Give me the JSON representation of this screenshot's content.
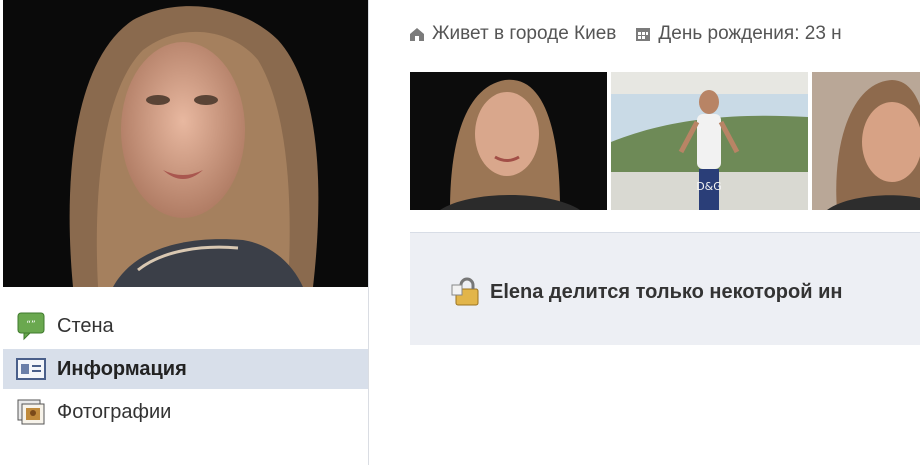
{
  "info": {
    "city": "Живет в городе Киев",
    "birthday": "День рождения: 23 н"
  },
  "nav": {
    "items": [
      {
        "label": "Стена"
      },
      {
        "label": "Информация"
      },
      {
        "label": "Фотографии"
      }
    ]
  },
  "notice": {
    "text": "Elena делится только некоторой ин"
  },
  "photos": {
    "caption": "D&G"
  },
  "colors": {
    "active_nav_bg": "#d8dfea",
    "notice_bg": "#edeff4"
  }
}
